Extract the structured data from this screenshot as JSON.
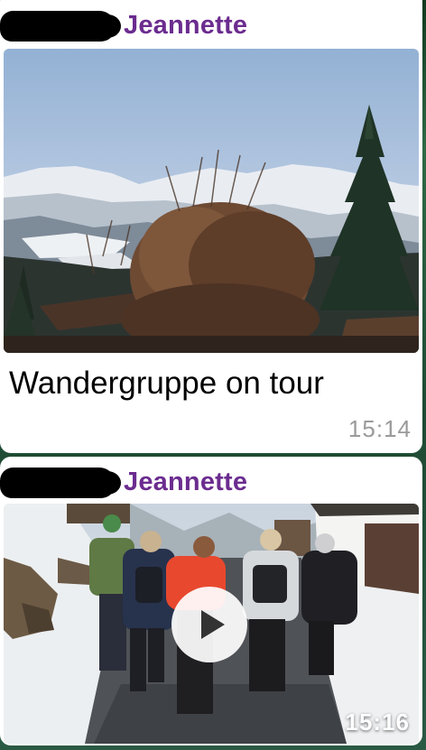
{
  "messages": [
    {
      "sender": "Jeannette",
      "media": {
        "kind": "photo",
        "description_icon": "photo-icon"
      },
      "caption": "Wandergruppe on tour",
      "time": "15:14"
    },
    {
      "sender": "Jeannette",
      "media": {
        "kind": "video",
        "description_icon": "play-icon"
      },
      "time": "15:16"
    }
  ],
  "colors": {
    "sender_name": "#6b2c8f",
    "bubble": "#ffffff",
    "timestamp": "#9a9a9a",
    "chat_background": "#2f6a46"
  }
}
